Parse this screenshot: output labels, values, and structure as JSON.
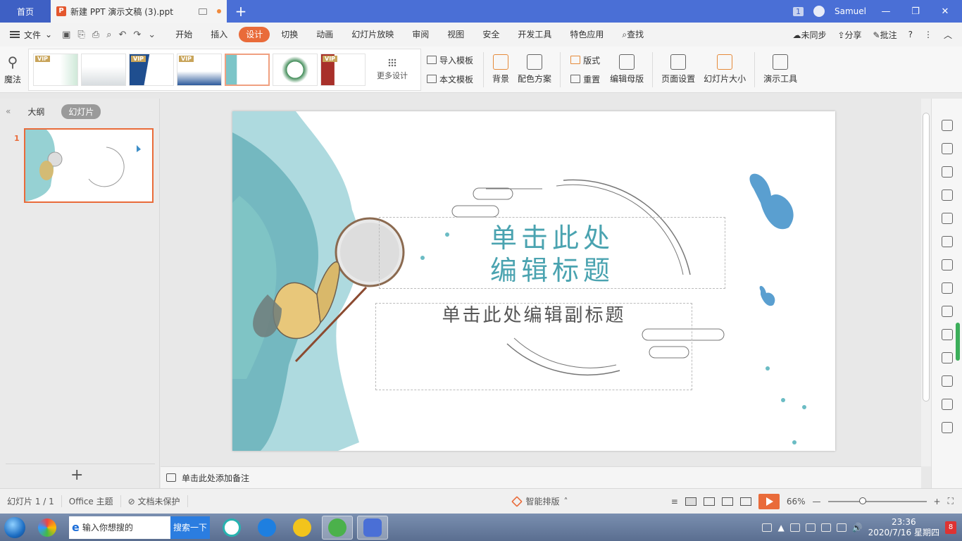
{
  "titlebar": {
    "home_tab": "首页",
    "doc_tab": "新建 PPT 演示文稿 (3).ppt",
    "window_count": "1",
    "user": "Samuel"
  },
  "menubar": {
    "file": "文件",
    "items": [
      "开始",
      "插入",
      "设计",
      "切换",
      "动画",
      "幻灯片放映",
      "审阅",
      "视图",
      "安全",
      "开发工具",
      "特色应用"
    ],
    "active": "设计",
    "search": "查找",
    "sync": "未同步",
    "share": "分享",
    "comment": "批注"
  },
  "ribbon": {
    "magic": "魔法",
    "more_design": "更多设计",
    "import_template": "导入模板",
    "this_template": "本文模板",
    "background": "背景",
    "color_scheme": "配色方案",
    "layout": "版式",
    "reset": "重置",
    "edit_master": "编辑母版",
    "page_setup": "页面设置",
    "slide_size": "幻灯片大小",
    "presentation_tools": "演示工具",
    "vip_label": "VIP"
  },
  "leftpanel": {
    "tab_outline": "大纲",
    "tab_slides": "幻灯片",
    "slide_number": "1"
  },
  "slide": {
    "title": "单击此处\n编辑标题",
    "subtitle": "单击此处编辑副标题"
  },
  "notes": {
    "placeholder": "单击此处添加备注"
  },
  "statusbar": {
    "slide_count": "幻灯片 1 / 1",
    "theme": "Office 主题",
    "protection": "文档未保护",
    "smart_layout": "智能排版",
    "zoom": "66%",
    "zoom_value": 0.66
  },
  "taskbar": {
    "search_placeholder": "输入你想搜的",
    "search_button": "搜索一下",
    "time": "23:36",
    "date": "2020/7/16 星期四",
    "notifications": "8"
  },
  "colors": {
    "accent": "#e96b3a",
    "titlebar": "#4a6fd6",
    "title_text": "#4aa3b0"
  }
}
